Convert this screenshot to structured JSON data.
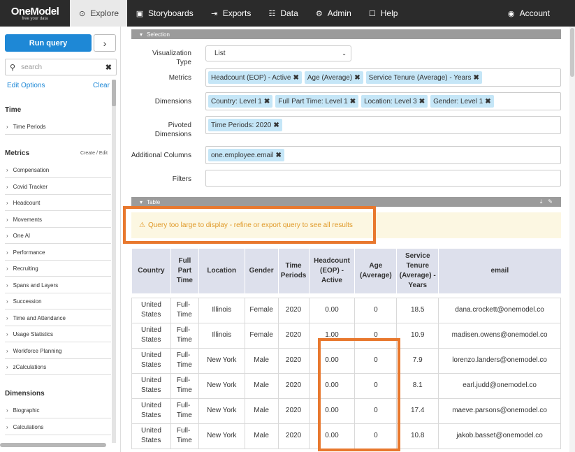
{
  "nav": {
    "logo": "OneModel",
    "tagline": "free your data",
    "items": [
      {
        "label": "Explore",
        "icon": "compass-icon"
      },
      {
        "label": "Storyboards",
        "icon": "storyboard-icon"
      },
      {
        "label": "Exports",
        "icon": "export-icon"
      },
      {
        "label": "Data",
        "icon": "data-icon"
      },
      {
        "label": "Admin",
        "icon": "gear-icon"
      },
      {
        "label": "Help",
        "icon": "help-icon"
      },
      {
        "label": "Account",
        "icon": "user-icon"
      }
    ]
  },
  "sidebar": {
    "run_label": "Run query",
    "search_placeholder": "search",
    "edit_options": "Edit Options",
    "clear": "Clear",
    "time_title": "Time",
    "time_items": [
      "Time Periods"
    ],
    "metrics_title": "Metrics",
    "metrics_link": "Create / Edit",
    "metrics_items": [
      "Compensation",
      "Covid Tracker",
      "Headcount",
      "Movements",
      "One AI",
      "Performance",
      "Recruiting",
      "Spans and Layers",
      "Succession",
      "Time and Attendance",
      "Usage Statistics",
      "Workforce Planning",
      "zCalculations"
    ],
    "dimensions_title": "Dimensions",
    "dimensions_items": [
      "Biographic",
      "Calculations"
    ]
  },
  "selection": {
    "header": "Selection",
    "viz_label": "Visualization Type",
    "viz_value": "List",
    "metrics_label": "Metrics",
    "metrics": [
      "Headcount (EOP) - Active",
      "Age (Average)",
      "Service Tenure (Average) - Years"
    ],
    "dimensions_label": "Dimensions",
    "dimensions": [
      "Country: Level 1",
      "Full Part Time: Level 1",
      "Location: Level 3",
      "Gender: Level 1"
    ],
    "pivoted_label_1": "Pivoted",
    "pivoted_label_2": "Dimensions",
    "pivoted": [
      "Time Periods: 2020"
    ],
    "additional_label": "Additional Columns",
    "additional": [
      "one.employee.email"
    ],
    "filters_label": "Filters"
  },
  "table": {
    "header": "Table",
    "warning": "Query too large to display - refine or export query to see all results",
    "columns": [
      "Country",
      "Full Part Time",
      "Location",
      "Gender",
      "Time Periods",
      "Headcount (EOP) - Active",
      "Age (Average)",
      "Service Tenure (Average) - Years",
      "email"
    ],
    "rows": [
      [
        "United States",
        "Full-Time",
        "Illinois",
        "Female",
        "2020",
        "0.00",
        "0",
        "18.5",
        "dana.crockett@onemodel.co"
      ],
      [
        "United States",
        "Full-Time",
        "Illinois",
        "Female",
        "2020",
        "1.00",
        "0",
        "10.9",
        "madisen.owens@onemodel.co"
      ],
      [
        "United States",
        "Full-Time",
        "New York",
        "Male",
        "2020",
        "0.00",
        "0",
        "7.9",
        "lorenzo.landers@onemodel.co"
      ],
      [
        "United States",
        "Full-Time",
        "New York",
        "Male",
        "2020",
        "0.00",
        "0",
        "8.1",
        "earl.judd@onemodel.co"
      ],
      [
        "United States",
        "Full-Time",
        "New York",
        "Male",
        "2020",
        "0.00",
        "0",
        "17.4",
        "maeve.parsons@onemodel.co"
      ],
      [
        "United States",
        "Full-Time",
        "New York",
        "Male",
        "2020",
        "0.00",
        "0",
        "10.8",
        "jakob.basset@onemodel.co"
      ]
    ]
  },
  "colors": {
    "accent": "#1e88d6",
    "tag": "#c5e6f7",
    "warning": "#e09a29",
    "highlight": "#e8782e"
  }
}
